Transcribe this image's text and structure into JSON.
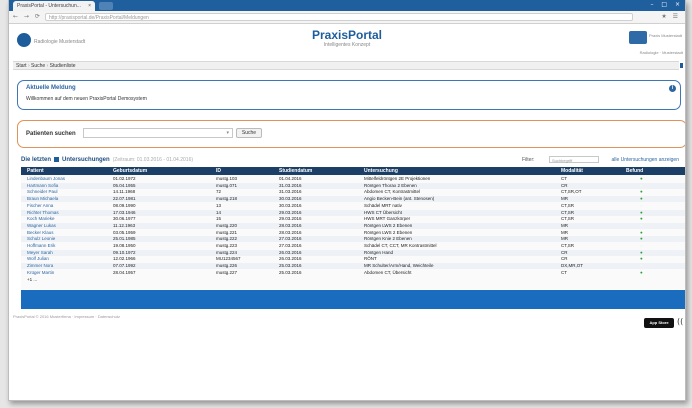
{
  "browser": {
    "tab_title": "PraxisPortal - Untersuchun...",
    "tab_close": "×",
    "nav_buttons": "← → ⟳ ⌂",
    "url": "http://praxisportal.de/PraxisPortal/Meldungen",
    "right_buttons": "★ ☰",
    "window_buttons": "– □ ×"
  },
  "header": {
    "title": "PraxisPortal",
    "subtitle": "Intelligentes Konzept",
    "left_logo_text": "Radiologie Musterstadt",
    "right_logo_text": "Praxis Musterstadt",
    "right_sub_text": "Radiologie · Musterstadt"
  },
  "breadcrumb": {
    "items": [
      "Start",
      "Suche",
      "Studienliste"
    ],
    "sep": "›"
  },
  "notice": {
    "title": "Aktuelle Meldung",
    "text": "Willkommen auf dem neuen PraxisPortal Demosystem",
    "info_icon": "i"
  },
  "search": {
    "label": "Patienten suchen",
    "placeholder": "",
    "dropdown_icon": "▾",
    "button": "Suche"
  },
  "exams": {
    "title_left": "Die letzten",
    "title_right": "Untersuchungen",
    "range": "(Zeitraum: 01.03.2016 - 01.04.2016)",
    "filter_label": "Filter:",
    "filter_placeholder": "Suchbegriff",
    "show_all": "alle Untersuchungen anzeigen",
    "columns": [
      "Patient",
      "Geburtsdatum",
      "ID",
      "Studiendatum",
      "Untersuchung",
      "Modalität",
      "Befund"
    ],
    "rows": [
      [
        "Lindenbaum Jonas",
        "01.02.1972",
        "mustg.103",
        "01.04.2016",
        "Mittelfeldröntgen 2E Projektionen",
        "CT",
        "●"
      ],
      [
        "Hartmann Sofia",
        "05.04.1955",
        "mustg.071",
        "31.03.2016",
        "Röntgen Thorax 2 Ebenen",
        "CR",
        "●"
      ],
      [
        "Schneider Paul",
        "14.11.1968",
        "72",
        "31.03.2016",
        "Abdomen CT, Kontrastmittel",
        "CT,SR,OT",
        "●"
      ],
      [
        "Braun Michaela",
        "22.07.1981",
        "mustg.218",
        "30.03.2016",
        "Angio Becken-Bein (ant. Stenosen)",
        "MR",
        "●"
      ],
      [
        "Fischer Anna",
        "08.09.1990",
        "13",
        "30.03.2016",
        "Schädel MRT nativ",
        "CT,SR",
        "●"
      ],
      [
        "Richter Thomas",
        "17.03.1946",
        "14",
        "29.03.2016",
        "HWS CT Übersicht",
        "CT,SR",
        "●"
      ],
      [
        "Koch Marieke",
        "30.06.1977",
        "15",
        "29.03.2016",
        "HWS MRT Ganzkörper",
        "CT,SR",
        "●"
      ],
      [
        "Wagner Lukas",
        "11.12.1963",
        "mustg.220",
        "28.03.2016",
        "Röntgen LWS 2 Ebenen",
        "MR",
        "●"
      ],
      [
        "Becker Klaus",
        "03.05.1959",
        "mustg.221",
        "28.03.2016",
        "Röntgen LWS 2 Ebenen",
        "MR",
        "●"
      ],
      [
        "Schulz Leonie",
        "25.01.1985",
        "mustg.222",
        "27.03.2016",
        "Röntgen Knie 2 Ebenen",
        "MR",
        "●"
      ],
      [
        "Hoffmann Erik",
        "19.08.1950",
        "mustg.223",
        "27.03.2016",
        "Schädel CT, CCT, MR Kontrastmittel",
        "CT,SR",
        "●"
      ],
      [
        "Meyer Sarah",
        "09.10.1972",
        "mustg.224",
        "26.03.2016",
        "Röntgen Hand",
        "CR",
        "●"
      ],
      [
        "Wolf Julian",
        "12.02.1966",
        "MU1234567",
        "26.03.2016",
        "RÖNT",
        "CR",
        "●"
      ],
      [
        "Zimmer Nora",
        "07.07.1992",
        "mustg.226",
        "25.03.2016",
        "MR Schulter/Arm/Hand, Weichteile",
        "DX,MR,OT",
        "●"
      ],
      [
        "Krüger Martin",
        "28.04.1957",
        "mustg.227",
        "25.03.2016",
        "Abdomen CT, Übersicht",
        "CT",
        "●"
      ]
    ],
    "more": "+1 ..."
  },
  "footer": {
    "text": "PraxisPortal © 2016 Musterfirma · Impressum · Datenschutz",
    "link": "Impressum",
    "store_badge": "App Store",
    "edge_text": "(("
  },
  "colors": {
    "brand": "#1e5d9c",
    "notice_border": "#3d78b4",
    "search_border": "#e0925a",
    "table_header": "#1b3f66",
    "bottom_bar": "#1a6cbf",
    "status_green": "#2f9e3e",
    "status_white": "#f5f5f5"
  }
}
